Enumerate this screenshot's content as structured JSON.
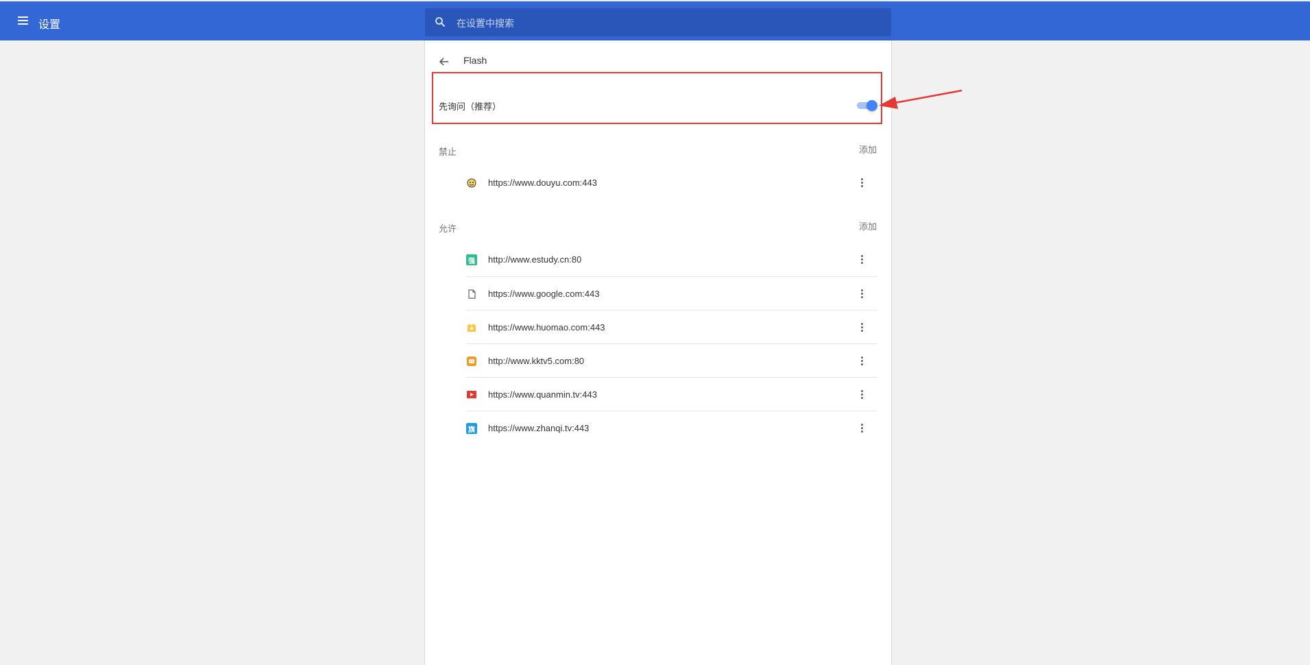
{
  "header": {
    "title": "设置",
    "search_placeholder": "在设置中搜索"
  },
  "page": {
    "title": "Flash"
  },
  "toggle": {
    "label": "先询问（推荐）",
    "checked": true
  },
  "blocked": {
    "label": "禁止",
    "add_label": "添加",
    "items": [
      {
        "url": "https://www.douyu.com:443",
        "icon": "douyu-favicon"
      }
    ]
  },
  "allowed": {
    "label": "允许",
    "add_label": "添加",
    "items": [
      {
        "url": "http://www.estudy.cn:80",
        "icon": "estudy-favicon",
        "icon_text": "强"
      },
      {
        "url": "https://www.google.com:443",
        "icon": "file-icon"
      },
      {
        "url": "https://www.huomao.com:443",
        "icon": "huomao-favicon"
      },
      {
        "url": "http://www.kktv5.com:80",
        "icon": "kktv5-favicon"
      },
      {
        "url": "https://www.quanmin.tv:443",
        "icon": "quanmin-favicon"
      },
      {
        "url": "https://www.zhanqi.tv:443",
        "icon": "zhanqi-favicon",
        "icon_text": "旗"
      }
    ]
  },
  "colors": {
    "header": "#3367d6",
    "search_bg": "#2a56b9",
    "toggle_on": "#4285f4",
    "highlight": "#e53935"
  }
}
